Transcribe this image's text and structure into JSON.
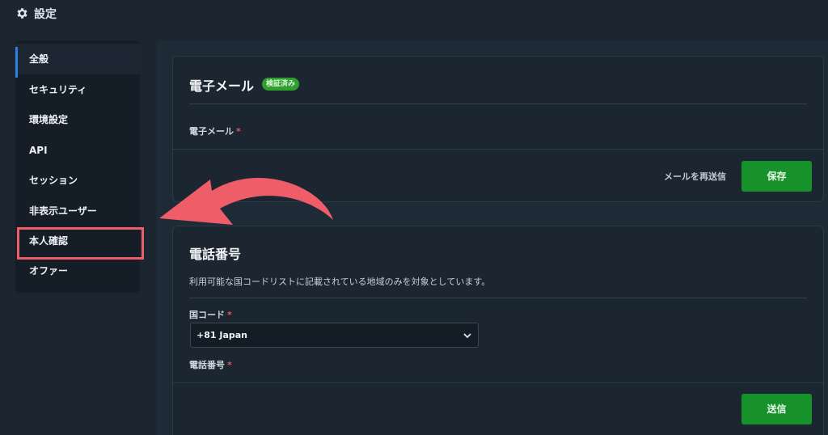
{
  "header": {
    "title": "設定",
    "icon": "gear-icon"
  },
  "sidebar": {
    "items": [
      {
        "label": "全般",
        "active": true
      },
      {
        "label": "セキュリティ"
      },
      {
        "label": "環境設定"
      },
      {
        "label": "API"
      },
      {
        "label": "セッション"
      },
      {
        "label": "非表示ユーザー"
      },
      {
        "label": "本人確認",
        "highlighted": true
      },
      {
        "label": "オファー"
      }
    ]
  },
  "email": {
    "title": "電子メール",
    "badge": "検証済み",
    "field_label": "電子メール",
    "required": "*",
    "resend_label": "メールを再送信",
    "save_label": "保存"
  },
  "phone": {
    "title": "電話番号",
    "description": "利用可能な国コードリストに記載されている地域のみを対象としています。",
    "country_label": "国コード",
    "country_value": "+81 Japan",
    "phone_label": "電話番号",
    "required": "*",
    "send_label": "送信"
  },
  "colors": {
    "background": "#1b2631",
    "accent_green": "#17912a",
    "highlight_red": "#ef5d68",
    "active_indicator": "#2f7fe0"
  }
}
